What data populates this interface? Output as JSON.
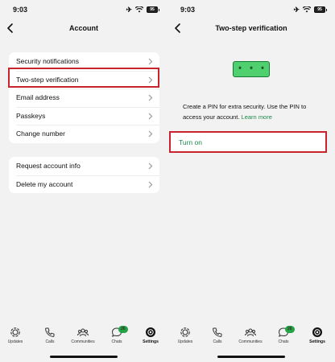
{
  "left": {
    "status": {
      "time": "9:03",
      "battery": "95"
    },
    "title": "Account",
    "group1": [
      {
        "label": "Security notifications"
      },
      {
        "label": "Two-step verification"
      },
      {
        "label": "Email address"
      },
      {
        "label": "Passkeys"
      },
      {
        "label": "Change number"
      }
    ],
    "group2": [
      {
        "label": "Request account info"
      },
      {
        "label": "Delete my account"
      }
    ]
  },
  "right": {
    "status": {
      "time": "9:03",
      "battery": "95"
    },
    "title": "Two-step verification",
    "pin_mask": "* * *",
    "description": "Create a PIN for extra security. Use the PIN to access your account.",
    "learn_more": "Learn more",
    "turn_on": "Turn on"
  },
  "tabbar": {
    "items": [
      {
        "label": "Updates",
        "icon": "updates-icon"
      },
      {
        "label": "Calls",
        "icon": "calls-icon"
      },
      {
        "label": "Communities",
        "icon": "communities-icon"
      },
      {
        "label": "Chats",
        "icon": "chats-icon",
        "badge": "26"
      },
      {
        "label": "Settings",
        "icon": "settings-icon",
        "active": true
      }
    ]
  },
  "colors": {
    "accent": "#1c8a4a",
    "highlight": "#c8242e",
    "badge": "#25a244",
    "pin_bg": "#4fcf6e"
  }
}
